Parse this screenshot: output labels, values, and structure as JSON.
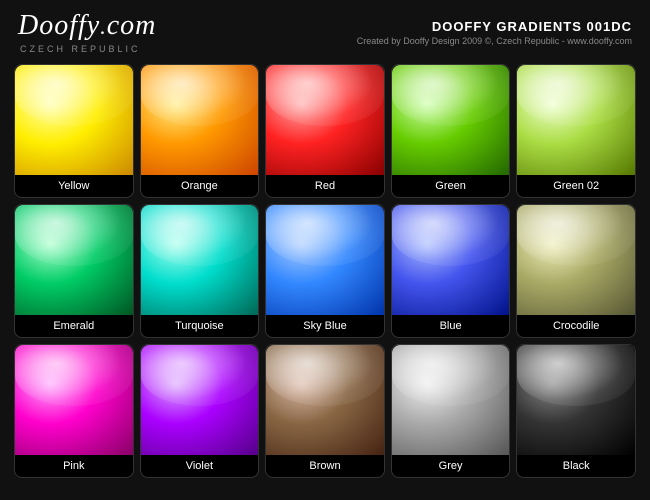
{
  "header": {
    "logo": "Dooffy.com",
    "logo_sub": "czech republic",
    "title": "DOOFFY GRADIENTS 001DC",
    "subtitle": "Created by Dooffy Design 2009 ©, Czech Republic - www.dooffy.com"
  },
  "swatches": [
    {
      "id": "yellow",
      "label": "Yellow",
      "class": "swatch-yellow"
    },
    {
      "id": "orange",
      "label": "Orange",
      "class": "swatch-orange"
    },
    {
      "id": "red",
      "label": "Red",
      "class": "swatch-red"
    },
    {
      "id": "green",
      "label": "Green",
      "class": "swatch-green"
    },
    {
      "id": "green02",
      "label": "Green 02",
      "class": "swatch-green02"
    },
    {
      "id": "emerald",
      "label": "Emerald",
      "class": "swatch-emerald"
    },
    {
      "id": "turquoise",
      "label": "Turquoise",
      "class": "swatch-turquoise"
    },
    {
      "id": "skyblue",
      "label": "Sky Blue",
      "class": "swatch-skyblue"
    },
    {
      "id": "blue",
      "label": "Blue",
      "class": "swatch-blue"
    },
    {
      "id": "crocodile",
      "label": "Crocodile",
      "class": "swatch-crocodile"
    },
    {
      "id": "pink",
      "label": "Pink",
      "class": "swatch-pink"
    },
    {
      "id": "violet",
      "label": "Violet",
      "class": "swatch-violet"
    },
    {
      "id": "brown",
      "label": "Brown",
      "class": "swatch-brown"
    },
    {
      "id": "grey",
      "label": "Grey",
      "class": "swatch-grey"
    },
    {
      "id": "black",
      "label": "Black",
      "class": "swatch-black"
    }
  ]
}
